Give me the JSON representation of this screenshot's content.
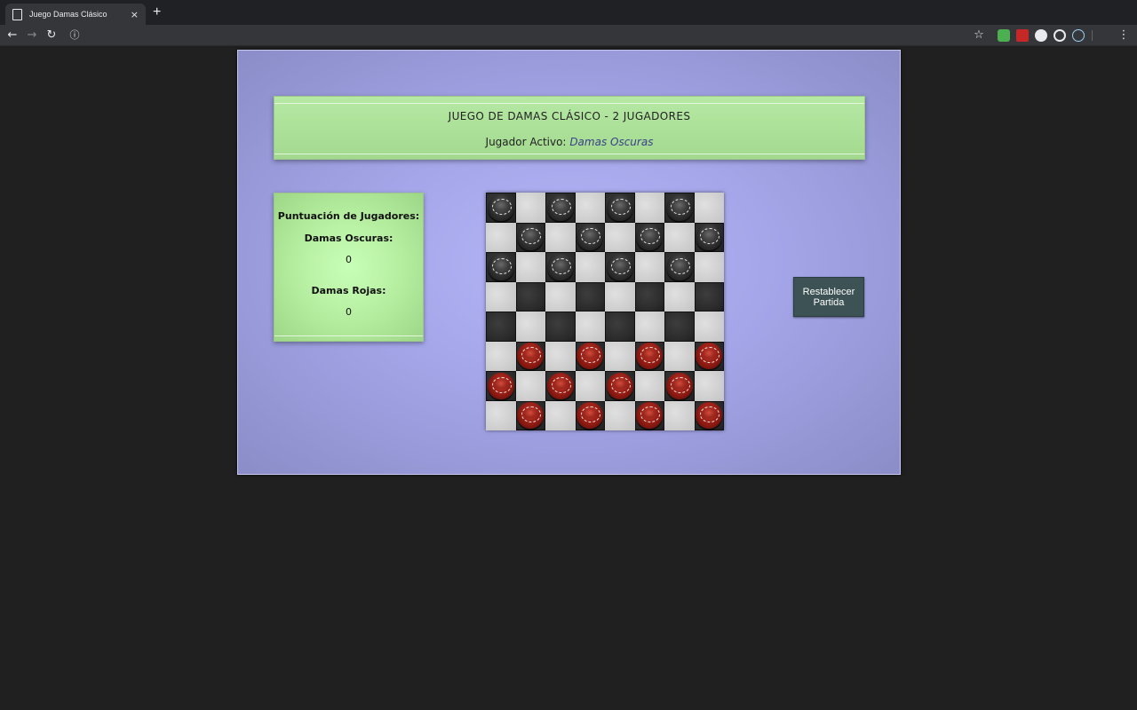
{
  "browser": {
    "tab_title": "Juego Damas Clásico",
    "tab_close": "×",
    "new_tab": "+",
    "icons": {
      "back": "←",
      "forward": "→",
      "reload": "↻",
      "info": "ⓘ",
      "star": "☆",
      "menu": "⋮"
    }
  },
  "header": {
    "title": "JUEGO DE DAMAS CLÁSICO - 2 JUGADORES",
    "active_label": "Jugador Activo:",
    "active_value": "Damas Oscuras"
  },
  "score": {
    "heading": "Puntuación de Jugadores:",
    "dark_label": "Damas Oscuras:",
    "dark_value": "0",
    "red_label": "Damas Rojas:",
    "red_value": "0"
  },
  "reset_button": "Restablecer Partida",
  "board": [
    [
      "b",
      null,
      "b",
      null,
      "b",
      null,
      "b",
      null
    ],
    [
      null,
      "b",
      null,
      "b",
      null,
      "b",
      null,
      "b"
    ],
    [
      "b",
      null,
      "b",
      null,
      "b",
      null,
      "b",
      null
    ],
    [
      null,
      null,
      null,
      null,
      null,
      null,
      null,
      null
    ],
    [
      null,
      null,
      null,
      null,
      null,
      null,
      null,
      null
    ],
    [
      null,
      "r",
      null,
      "r",
      null,
      "r",
      null,
      "r"
    ],
    [
      "r",
      null,
      "r",
      null,
      "r",
      null,
      "r",
      null
    ],
    [
      null,
      "r",
      null,
      "r",
      null,
      "r",
      null,
      "r"
    ]
  ],
  "colors": {
    "container": "#a3a5e8",
    "panel": "#b6e9a4",
    "reset_button": "#3c5254",
    "dark_piece": "#2e2e2e",
    "red_piece": "#8e1a12"
  }
}
